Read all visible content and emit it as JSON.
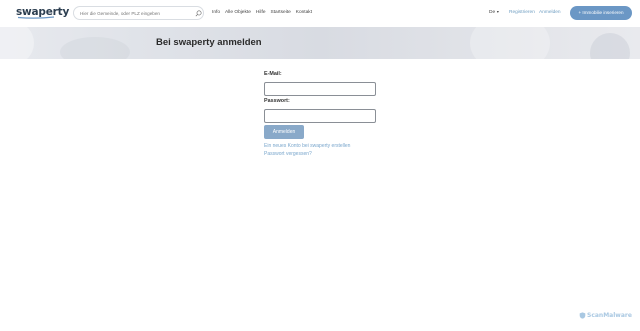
{
  "header": {
    "logo": "swaperty",
    "search_placeholder": "Hier die Gemeinde, oder PLZ eingeben",
    "nav": [
      "Info",
      "Alle Objekte",
      "Hilfe",
      "Startseite",
      "Kontakt"
    ],
    "language": "De",
    "register": "Registrieren",
    "login": "Anmelden",
    "cta": "+ Immobilie inserieren"
  },
  "hero": {
    "title": "Bei swaperty anmelden"
  },
  "form": {
    "email_label": "E-Mail:",
    "password_label": "Passwort:",
    "submit": "Anmelden",
    "register_link": "Ein neues Konto bei swaperty erstellen",
    "forgot_link": "Passwort vergessen?"
  },
  "watermark": "ScanMalware",
  "colors": {
    "brand_dark": "#2c3e50",
    "accent": "#6b97c5",
    "link": "#79a6cc",
    "button_disabled": "#89a9c9"
  }
}
